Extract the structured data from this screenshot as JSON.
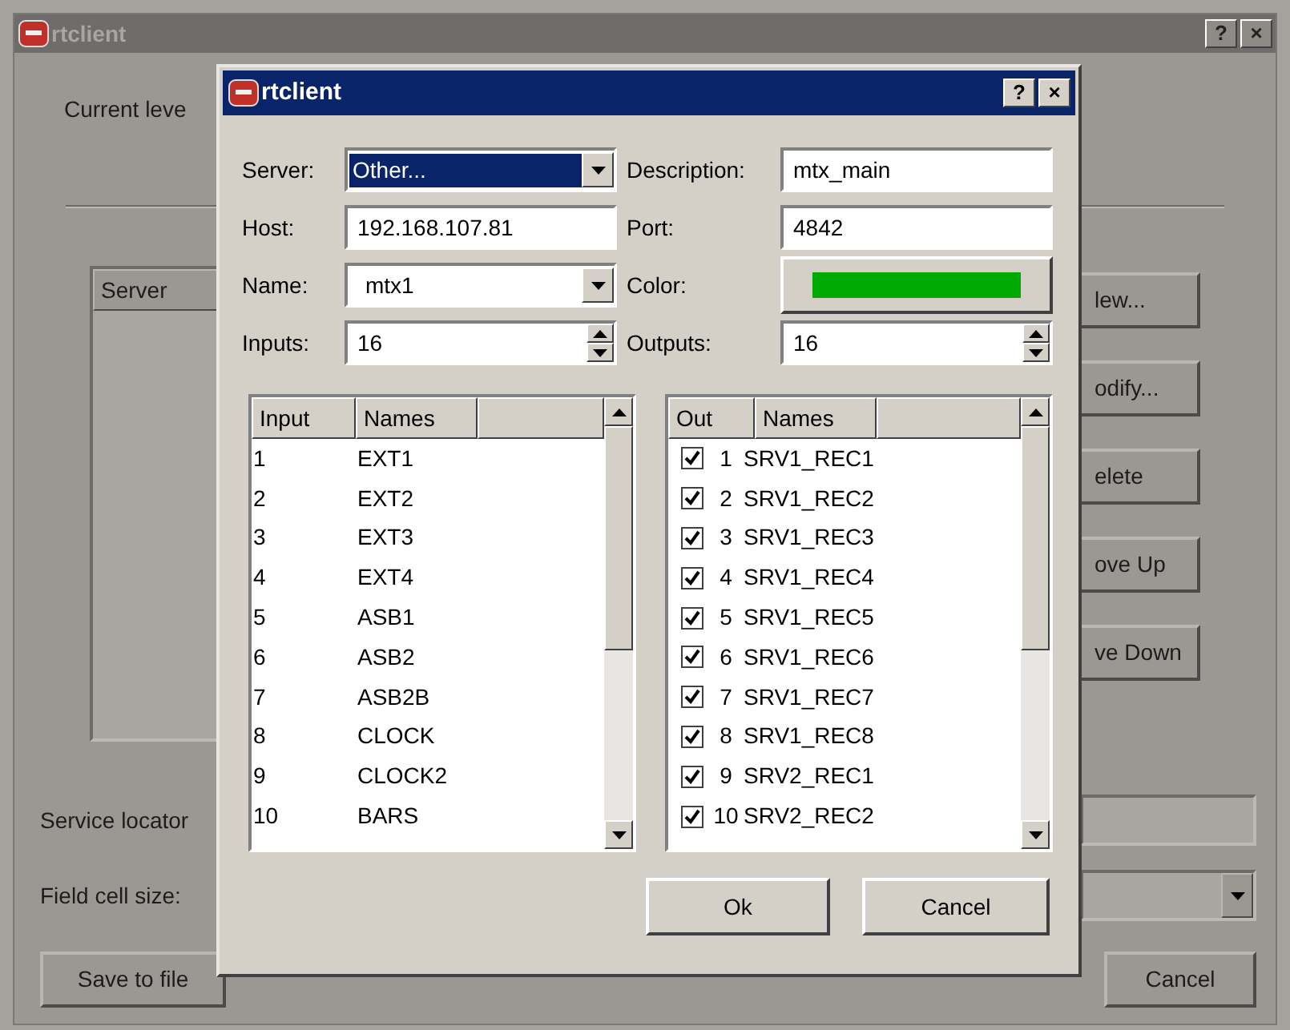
{
  "main_window": {
    "title": "rtclient",
    "current_level_label": "Current leve",
    "server_list": {
      "columns": [
        "Server"
      ]
    },
    "side_buttons": [
      "lew...",
      "odify...",
      "elete",
      "ove Up",
      "ve Down"
    ],
    "service_locator_label": "Service locator",
    "field_cell_size_label": "Field cell size:",
    "bottom_buttons": [
      "Save to file",
      "Cancel"
    ]
  },
  "dialog": {
    "title": "rtclient",
    "help_button": "?",
    "close_button": "×",
    "fields": [
      {
        "label": "Server:",
        "kind": "combo",
        "value": "Other...",
        "highlighted": true
      },
      {
        "label": "Description:",
        "kind": "text",
        "value": "mtx_main"
      },
      {
        "label": "Host:",
        "kind": "text",
        "value": "192.168.107.81"
      },
      {
        "label": "Port:",
        "kind": "text",
        "value": "4842"
      },
      {
        "label": "Name:",
        "kind": "combo",
        "value": "mtx1",
        "highlighted": false
      },
      {
        "label": "Color:",
        "kind": "color",
        "color": "#00aa00"
      },
      {
        "label": "Inputs:",
        "kind": "spin",
        "value": "16"
      },
      {
        "label": "Outputs:",
        "kind": "spin",
        "value": "16"
      }
    ],
    "inputs_table": {
      "columns": [
        "Input",
        "Names"
      ],
      "rows": [
        {
          "number": "1",
          "name": "EXT1"
        },
        {
          "number": "2",
          "name": "EXT2"
        },
        {
          "number": "3",
          "name": "EXT3"
        },
        {
          "number": "4",
          "name": "EXT4"
        },
        {
          "number": "5",
          "name": "ASB1"
        },
        {
          "number": "6",
          "name": "ASB2"
        },
        {
          "number": "7",
          "name": "ASB2B"
        },
        {
          "number": "8",
          "name": "CLOCK"
        },
        {
          "number": "9",
          "name": "CLOCK2"
        },
        {
          "number": "10",
          "name": "BARS"
        }
      ]
    },
    "outputs_table": {
      "columns": [
        "Out",
        "Names"
      ],
      "rows": [
        {
          "checked": true,
          "number": "1",
          "name": "SRV1_REC1"
        },
        {
          "checked": true,
          "number": "2",
          "name": "SRV1_REC2"
        },
        {
          "checked": true,
          "number": "3",
          "name": "SRV1_REC3"
        },
        {
          "checked": true,
          "number": "4",
          "name": "SRV1_REC4"
        },
        {
          "checked": true,
          "number": "5",
          "name": "SRV1_REC5"
        },
        {
          "checked": true,
          "number": "6",
          "name": "SRV1_REC6"
        },
        {
          "checked": true,
          "number": "7",
          "name": "SRV1_REC7"
        },
        {
          "checked": true,
          "number": "8",
          "name": "SRV1_REC8"
        },
        {
          "checked": true,
          "number": "9",
          "name": "SRV2_REC1"
        },
        {
          "checked": true,
          "number": "10",
          "name": "SRV2_REC2"
        }
      ]
    },
    "buttons": [
      "Ok",
      "Cancel"
    ]
  }
}
